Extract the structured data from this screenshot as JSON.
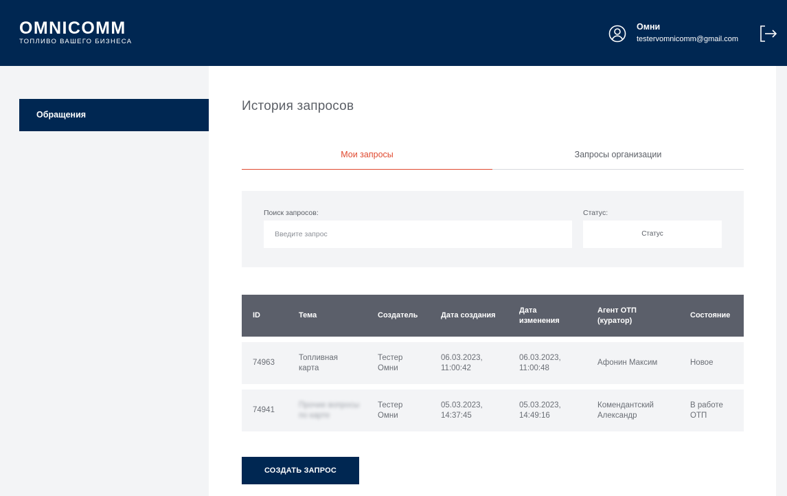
{
  "brand": {
    "name": "OMNICOMM",
    "tagline": "ТОПЛИВО ВАШЕГО БИЗНЕСА"
  },
  "user": {
    "name": "Омни",
    "email": "testervomnicomm@gmail.com"
  },
  "sidebar": {
    "items": [
      {
        "label": "Обращения",
        "active": true
      }
    ]
  },
  "page": {
    "title": "История запросов"
  },
  "tabs": [
    {
      "label": "Мои запросы",
      "active": true
    },
    {
      "label": "Запросы организации",
      "active": false
    }
  ],
  "filters": {
    "search_label": "Поиск запросов:",
    "search_placeholder": "Введите запрос",
    "status_label": "Статус:",
    "status_value": "Статус"
  },
  "table": {
    "headers": [
      "ID",
      "Тема",
      "Создатель",
      "Дата создания",
      "Дата\nизменения",
      "Агент ОТП\n(куратор)",
      "Состояние"
    ],
    "rows": [
      {
        "id": "74963",
        "topic": "Топливная\nкарта",
        "creator": "Тестер\nОмни",
        "created": "06.03.2023,\n11:00:42",
        "modified": "06.03.2023,\n11:00:48",
        "agent": "Афонин Максим",
        "status": "Новое"
      },
      {
        "id": "74941",
        "topic": "Прочие вопросы\nпо карте",
        "creator": "Тестер\nОмни",
        "created": "05.03.2023,\n14:37:45",
        "modified": "05.03.2023,\n14:49:16",
        "agent": "Комендантский\nАлександр",
        "status": "В работе\nОТП"
      }
    ]
  },
  "actions": {
    "create_label": "СОЗДАТЬ ЗАПРОС"
  },
  "colors": {
    "navy": "#002752",
    "accent": "#e0492f",
    "table_header": "#5b5f6a",
    "panel": "#f3f4f6"
  },
  "icons": {
    "user": "user-circle-icon",
    "logout": "logout-icon"
  }
}
